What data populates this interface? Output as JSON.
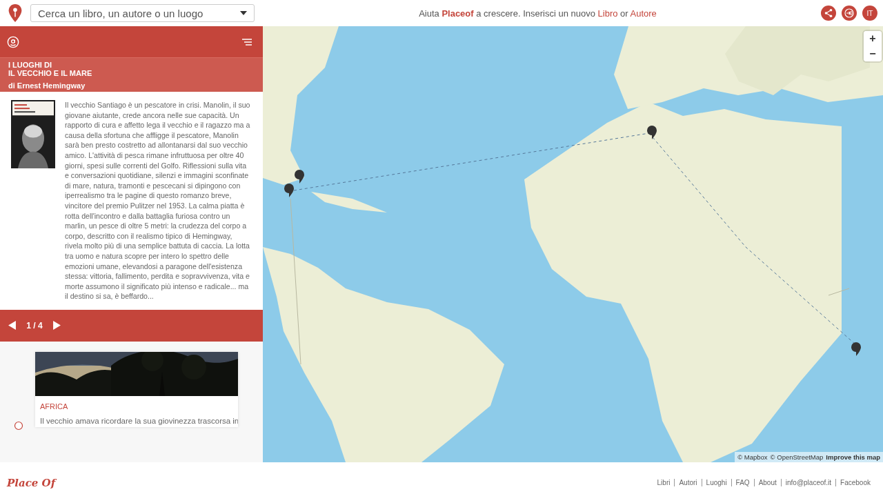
{
  "header": {
    "search": {
      "placeholder": "Cerca un libro, un autore o un luogo"
    },
    "prompt": [
      {
        "text": "Aiuta ",
        "kind": "plain"
      },
      {
        "text": "Placeof",
        "kind": "brand"
      },
      {
        "text": " a crescere. Inserisci un nuovo ",
        "kind": "plain"
      },
      {
        "text": "Libro",
        "kind": "link"
      },
      {
        "text": " or ",
        "kind": "plain"
      },
      {
        "text": "Autore",
        "kind": "link"
      }
    ],
    "language": "IT"
  },
  "book": {
    "heading_line1": "I LUOGHI DI",
    "heading_line2": "IL VECCHIO E IL MARE",
    "author": "di Ernest Hemingway",
    "summary": "Il vecchio Santiago è un pescatore in crisi. Manolin, il suo giovane aiutante, crede ancora nelle sue capacità. Un rapporto di cura e affetto lega il vecchio e il ragazzo ma a causa della sfortuna che affligge il pescatore, Manolin sarà ben presto costretto ad allontanarsi dal suo vecchio amico. L'attività di pesca rimane infruttuosa per oltre 40 giorni, spesi sulle correnti del Golfo. Riflessioni sulla vita e conversazioni quotidiane, silenzi e immagini sconfinate di mare, natura, tramonti e pescecani si dipingono con iperrealismo tra le pagine di questo romanzo breve, vincitore del premio Pulitzer nel 1953. La calma piatta è rotta dell'incontro e dalla battaglia furiosa contro un marlin, un pesce di oltre 5 metri: la crudezza del corpo a corpo, descritto con il realismo tipico di Hemingway, rivela molto più di una semplice battuta di caccia. La lotta tra uomo e natura scopre per intero lo spettro delle emozioni umane, elevandosi a paragone dell'esistenza stessa: vittoria, fallimento, perdita e sopravvivenza, vita e morte assumono il significato più intenso e radicale... ma il destino si sa, è beffardo...",
    "pager": "1 / 4"
  },
  "places": [
    {
      "name": "AFRICA",
      "text": "Il vecchio amava ricordare la sua giovinezza trascorsa in"
    }
  ],
  "map": {
    "zoom_in": "+",
    "zoom_out": "−",
    "attribution": [
      {
        "text": "© Mapbox",
        "kind": "plain"
      },
      {
        "text": "© OpenStreetMap",
        "kind": "plain"
      },
      {
        "text": "Improve this map",
        "kind": "bold"
      }
    ]
  },
  "footer": {
    "logo": "Place Of",
    "links": [
      "Libri",
      "Autori",
      "Luoghi",
      "FAQ",
      "About",
      "info@placeof.it",
      "Facebook"
    ]
  }
}
